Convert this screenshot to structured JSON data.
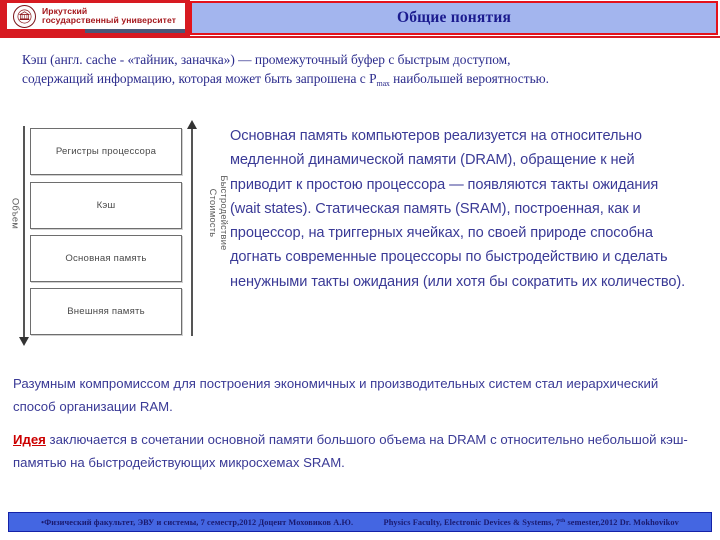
{
  "header": {
    "logo": {
      "line1": "Иркутский",
      "line2": "государственный университет",
      "emblem_icon": "university-crest-icon"
    },
    "title": "Общие понятия",
    "banner_fill": "#A3B5EE",
    "banner_border": "#E4121B",
    "brand_red": "#D71A21"
  },
  "intro": {
    "line1": "Кэш (англ. cache - «тайник, заначка») — промежуточный буфер с быстрым доступом,",
    "line2_before": "содержащий информацию, которая может быть запрошена с P",
    "line2_sub": "max",
    "line2_after": " наибольшей вероятностью."
  },
  "diagram": {
    "boxes": [
      "Регистры процессора",
      "Кэш",
      "Основная память",
      "Внешняя память"
    ],
    "left_axis_label": "Объем",
    "right_axis_label_line1": "Быстродействие",
    "right_axis_label_line2": "Стоимость",
    "left_arrow_icon": "arrow-down-icon",
    "right_arrow_icon": "arrow-up-icon"
  },
  "sidetext": {
    "body": "Основная память компьютеров реализуется на относительно медленной динамической памяти (DRAM), обращение к ней приводит к простою процессора — появляются такты ожидания (wait states). Статическая память (SRAM), построенная, как и процессор, на триггерных ячейках, по своей природе способна догнать современные процессоры по быстродействию и сделать ненужными такты ожидания (или хотя бы сократить их количество)."
  },
  "paragraphs": {
    "p1": "Разумным компромиссом для построения экономичных и производительных систем стал иерархический способ организации RAM.",
    "p2_keyword": "Идея",
    "p2_rest": " заключается в сочетании основной памяти большого объема на DRAM с относительно небольшой кэш-памятью на быстродействующих микросхемах SRAM.",
    "keyword_color": "#CC0000"
  },
  "footer": {
    "left": "•Физический факультет, ЭВУ и системы, 7 семестр,2012 Доцент Моховиков А.Ю.",
    "right_before": "Physics Faculty, Electronic Devices & Systems, 7",
    "right_sup": "th",
    "right_after": " semester,2012   Dr. Mokhovikov",
    "fill": "#4466E2"
  }
}
